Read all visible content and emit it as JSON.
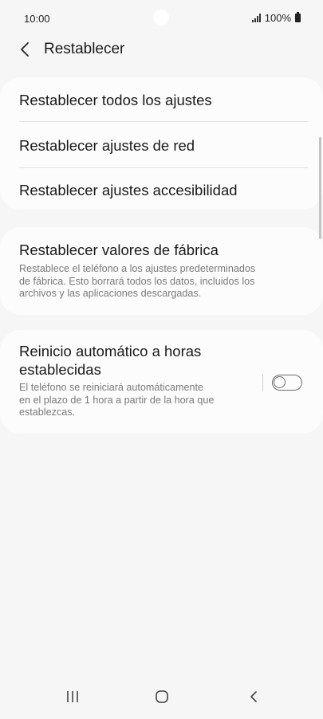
{
  "status_bar": {
    "time": "10:00",
    "battery": "100%",
    "icons": [
      "signal-icon",
      "battery-icon"
    ]
  },
  "header": {
    "title": "Restablecer",
    "back_icon": "chevron-left-icon"
  },
  "reset_group": {
    "items": [
      {
        "label": "Restablecer todos los ajustes"
      },
      {
        "label": "Restablecer ajustes de red"
      },
      {
        "label": "Restablecer ajustes accesibilidad"
      }
    ]
  },
  "factory_reset": {
    "title": "Restablecer valores de fábrica",
    "description_lines": [
      "Restablece el teléfono a los ajustes predeterminados",
      "de fábrica. Esto borrará todos los datos, incluidos los",
      "archivos y las aplicaciones descargadas."
    ]
  },
  "auto_restart": {
    "title_lines": [
      "Reinicio automático a horas",
      "establecidas"
    ],
    "description_lines": [
      "El teléfono se reiniciará automáticamente",
      "en el plazo de 1 hora a partir de la hora que",
      "establezcas."
    ],
    "toggle_on": false
  },
  "nav_bar": {
    "icons": [
      "recent-apps-icon",
      "home-icon",
      "back-icon"
    ]
  },
  "colors": {
    "background": "#f6f6f6",
    "card": "#fcfcfc",
    "text_primary": "#1a1a1a",
    "text_secondary": "#7a7a7a"
  }
}
